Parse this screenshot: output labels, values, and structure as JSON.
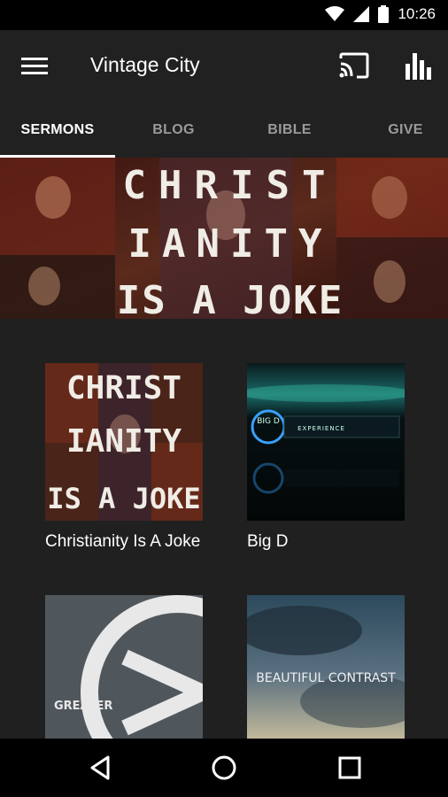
{
  "status_bar": {
    "time": "10:26",
    "icons": [
      "wifi-icon",
      "cell-signal-icon",
      "battery-icon"
    ]
  },
  "app_bar": {
    "title": "Vintage City",
    "icons": [
      "menu-icon",
      "cast-icon",
      "bar-chart-icon"
    ]
  },
  "tabs": [
    {
      "label": "SERMONS",
      "active": true
    },
    {
      "label": "BLOG",
      "active": false
    },
    {
      "label": "BIBLE",
      "active": false
    },
    {
      "label": "GIVE",
      "active": false
    }
  ],
  "banner": {
    "art_text": [
      "CHRIST",
      "IANITY",
      "IS A JOKE"
    ]
  },
  "series": [
    {
      "title": "Christianity Is A Joke",
      "art_text": [
        "CHRIST",
        "IANITY",
        "IS A JOKE"
      ]
    },
    {
      "title": "Big D",
      "art_text": [
        "BIG D",
        "EXPERIENCE"
      ]
    },
    {
      "title": "",
      "art_text": [
        "GREATER"
      ]
    },
    {
      "title": "",
      "art_text": [
        "BEAUTIFUL CONTRAST"
      ]
    }
  ],
  "nav_bar": {
    "icons": [
      "back-icon",
      "home-icon",
      "recents-icon"
    ]
  },
  "colors": {
    "background": "#202020",
    "app_bar": "#212121",
    "status_bar": "#000000",
    "tab_active": "#ffffff",
    "tab_inactive": "#9a9a9a"
  }
}
